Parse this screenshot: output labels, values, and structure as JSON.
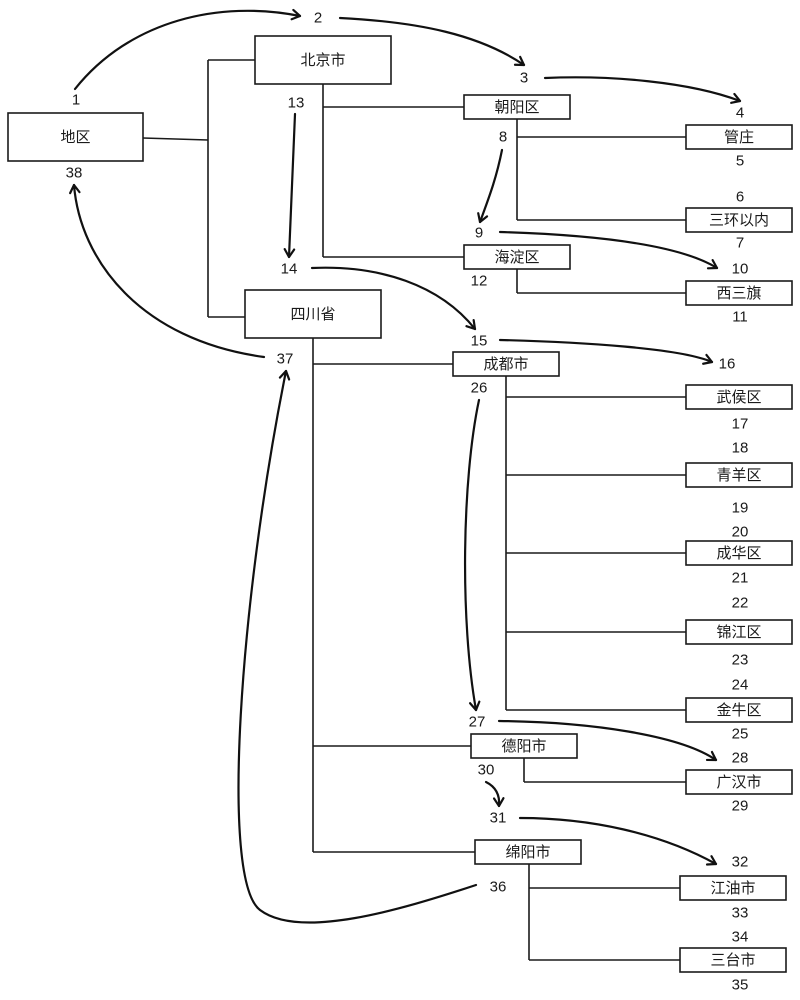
{
  "diagram": {
    "type": "tree-traversal",
    "nodes": [
      {
        "id": "root",
        "label": "地区"
      },
      {
        "id": "beijing",
        "label": "北京市"
      },
      {
        "id": "chaoyang",
        "label": "朝阳区"
      },
      {
        "id": "guanzhuang",
        "label": "管庄"
      },
      {
        "id": "sanhuan",
        "label": "三环以内"
      },
      {
        "id": "haidian",
        "label": "海淀区"
      },
      {
        "id": "xisanqi",
        "label": "西三旗"
      },
      {
        "id": "sichuan",
        "label": "四川省"
      },
      {
        "id": "chengdu",
        "label": "成都市"
      },
      {
        "id": "wuhou",
        "label": "武侯区"
      },
      {
        "id": "qingyang",
        "label": "青羊区"
      },
      {
        "id": "chenghua",
        "label": "成华区"
      },
      {
        "id": "jinjiang",
        "label": "锦江区"
      },
      {
        "id": "jinniu",
        "label": "金牛区"
      },
      {
        "id": "deyang",
        "label": "德阳市"
      },
      {
        "id": "guanghan",
        "label": "广汉市"
      },
      {
        "id": "mianyang",
        "label": "绵阳市"
      },
      {
        "id": "jiangyou",
        "label": "江油市"
      },
      {
        "id": "santai",
        "label": "三台市"
      }
    ],
    "edges": [
      [
        "root",
        "beijing"
      ],
      [
        "root",
        "sichuan"
      ],
      [
        "beijing",
        "chaoyang"
      ],
      [
        "beijing",
        "haidian"
      ],
      [
        "chaoyang",
        "guanzhuang"
      ],
      [
        "chaoyang",
        "sanhuan"
      ],
      [
        "haidian",
        "xisanqi"
      ],
      [
        "sichuan",
        "chengdu"
      ],
      [
        "sichuan",
        "deyang"
      ],
      [
        "sichuan",
        "mianyang"
      ],
      [
        "chengdu",
        "wuhou"
      ],
      [
        "chengdu",
        "qingyang"
      ],
      [
        "chengdu",
        "chenghua"
      ],
      [
        "chengdu",
        "jinjiang"
      ],
      [
        "chengdu",
        "jinniu"
      ],
      [
        "deyang",
        "guanghan"
      ],
      [
        "mianyang",
        "jiangyou"
      ],
      [
        "mianyang",
        "santai"
      ]
    ],
    "traversal_numbers": [
      "1",
      "2",
      "3",
      "4",
      "5",
      "6",
      "7",
      "8",
      "9",
      "10",
      "11",
      "12",
      "13",
      "14",
      "15",
      "16",
      "17",
      "18",
      "19",
      "20",
      "21",
      "22",
      "23",
      "24",
      "25",
      "26",
      "27",
      "28",
      "29",
      "30",
      "31",
      "32",
      "33",
      "34",
      "35",
      "36",
      "37",
      "38"
    ],
    "traversal_arrows": [
      [
        "1",
        "2"
      ],
      [
        "2",
        "3"
      ],
      [
        "3",
        "4"
      ],
      [
        "8",
        "9"
      ],
      [
        "9",
        "10"
      ],
      [
        "13",
        "14"
      ],
      [
        "14",
        "15"
      ],
      [
        "15",
        "16"
      ],
      [
        "26",
        "27"
      ],
      [
        "27",
        "28"
      ],
      [
        "30",
        "31"
      ],
      [
        "31",
        "32"
      ],
      [
        "36",
        "37"
      ],
      [
        "37",
        "38"
      ]
    ]
  }
}
